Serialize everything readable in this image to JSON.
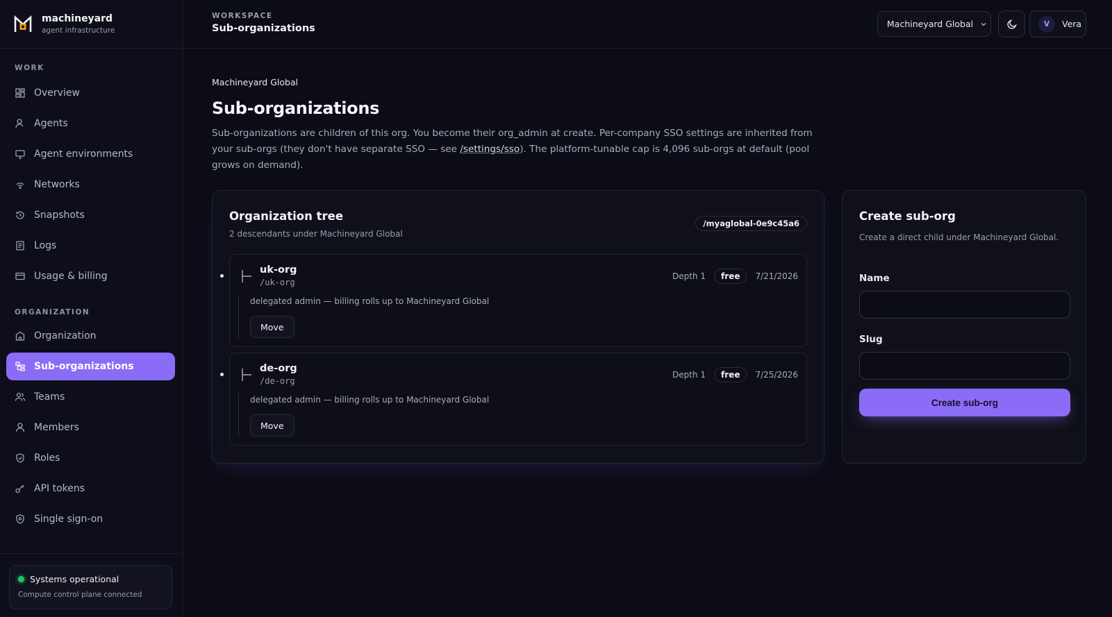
{
  "brand": {
    "name": "machineyard",
    "tagline": "agent infrastructure"
  },
  "sidebar": {
    "sections": [
      {
        "label": "WORK"
      },
      {
        "label": "ORGANIZATION"
      }
    ],
    "items": [
      {
        "label": "Overview",
        "icon": "grid-icon"
      },
      {
        "label": "Agents",
        "icon": "user-icon"
      },
      {
        "label": "Agent environments",
        "icon": "monitor-icon"
      },
      {
        "label": "Networks",
        "icon": "wifi-icon"
      },
      {
        "label": "Snapshots",
        "icon": "history-icon"
      },
      {
        "label": "Logs",
        "icon": "document-icon"
      },
      {
        "label": "Usage & billing",
        "icon": "card-icon"
      },
      {
        "label": "Organization",
        "icon": "building-icon"
      },
      {
        "label": "Sub-organizations",
        "icon": "hierarchy-icon",
        "active": true
      },
      {
        "label": "Teams",
        "icon": "users-icon"
      },
      {
        "label": "Members",
        "icon": "user-icon"
      },
      {
        "label": "Roles",
        "icon": "shield-icon"
      },
      {
        "label": "API tokens",
        "icon": "key-icon"
      },
      {
        "label": "Single sign-on",
        "icon": "shield-check-icon"
      }
    ],
    "status": {
      "title": "Systems operational",
      "subtitle": "Compute control plane connected",
      "color": "#22c55e"
    }
  },
  "header": {
    "workspace_label": "WORKSPACE",
    "title": "Sub-organizations",
    "org_selector": "Machineyard Global",
    "user": {
      "initial": "V",
      "name": "Vera"
    }
  },
  "main": {
    "breadcrumb": "Machineyard Global",
    "title": "Sub-organizations",
    "desc_part1": "Sub-organizations are children of this org. You become their org_admin at create. Per-company SSO settings are inherited from your sub-orgs (they don't have separate SSO — see ",
    "desc_link": "/settings/sso",
    "desc_part2": "). The platform-tunable cap is 4,096 sub-orgs at default (pool grows on demand).",
    "tree": {
      "title": "Organization tree",
      "subtitle": "2 descendants under Machineyard Global",
      "slug": "/myaglobal-0e9c45a6",
      "orgs": [
        {
          "name": "uk-org",
          "slug": "/uk-org",
          "depth": "Depth 1",
          "plan": "free",
          "date": "7/21/2026",
          "note": "delegated admin — billing rolls up to Machineyard Global",
          "action": "Move"
        },
        {
          "name": "de-org",
          "slug": "/de-org",
          "depth": "Depth 1",
          "plan": "free",
          "date": "7/25/2026",
          "note": "delegated admin — billing rolls up to Machineyard Global",
          "action": "Move"
        }
      ]
    },
    "create": {
      "title": "Create sub-org",
      "subtitle": "Create a direct child under Machineyard Global.",
      "name_label": "Name",
      "name_value": "",
      "slug_label": "Slug",
      "slug_value": "",
      "button": "Create sub-org"
    }
  },
  "colors": {
    "accent": "#8b6cf6",
    "background": "#0b0c16"
  }
}
